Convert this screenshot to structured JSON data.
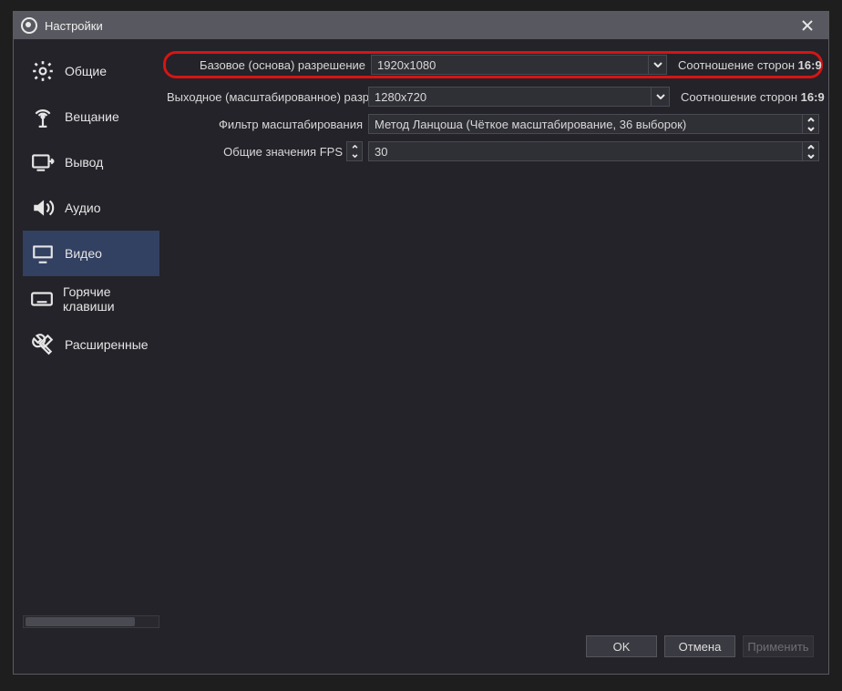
{
  "window": {
    "title": "Настройки"
  },
  "sidebar": {
    "items": [
      {
        "label": "Общие"
      },
      {
        "label": "Вещание"
      },
      {
        "label": "Вывод"
      },
      {
        "label": "Аудио"
      },
      {
        "label": "Видео"
      },
      {
        "label": "Горячие клавиши"
      },
      {
        "label": "Расширенные"
      }
    ]
  },
  "video": {
    "base_label": "Базовое (основа) разрешение",
    "base_value": "1920x1080",
    "base_aspect_label": "Соотношение сторон",
    "base_aspect_value": "16:9",
    "output_label": "Выходное (масштабированное) разрешение",
    "output_value": "1280x720",
    "output_aspect_label": "Соотношение сторон",
    "output_aspect_value": "16:9",
    "filter_label": "Фильтр масштабирования",
    "filter_value": "Метод Ланцоша (Чёткое масштабирование, 36 выборок)",
    "fps_label": "Общие значения FPS",
    "fps_value": "30"
  },
  "buttons": {
    "ok": "OK",
    "cancel": "Отмена",
    "apply": "Применить"
  }
}
